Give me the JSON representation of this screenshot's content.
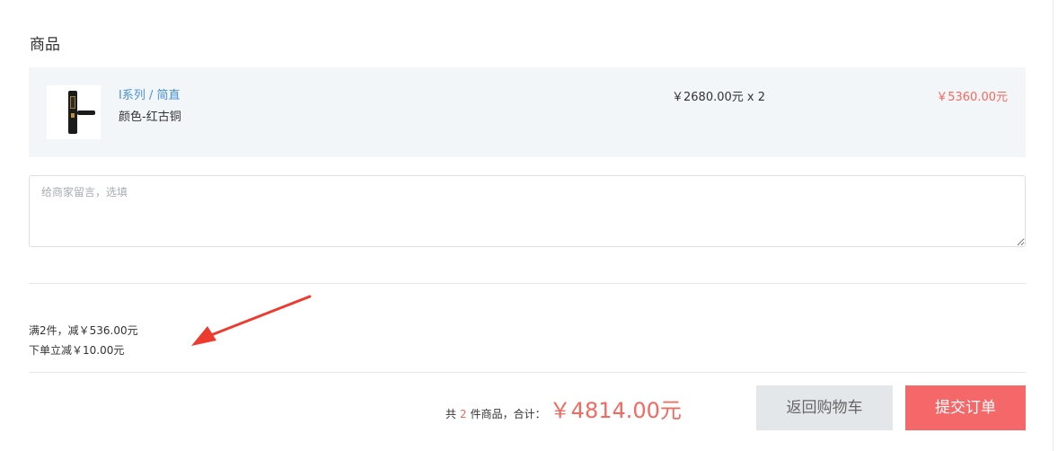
{
  "section": {
    "title": "商品"
  },
  "product": {
    "name": "I系列 / 简直",
    "variant": "颜色-红古铜",
    "price_qty": "￥2680.00元 x 2",
    "line_total": "￥5360.00元",
    "image_icon": "smart-lock-image"
  },
  "message": {
    "placeholder": "给商家留言，选填",
    "value": ""
  },
  "promotions": [
    "满2件，减￥536.00元",
    "下单立减￥10.00元"
  ],
  "summary": {
    "prefix": "共",
    "count": "2",
    "suffix": "件商品，合计：",
    "total": "￥4814.00元"
  },
  "buttons": {
    "back_label": "返回购物车",
    "submit_label": "提交订单"
  },
  "colors": {
    "accent_red": "#f4695f",
    "link_blue": "#4a90d9",
    "card_bg": "#f2f6f9",
    "annotation_arrow": "#ee3b30"
  }
}
